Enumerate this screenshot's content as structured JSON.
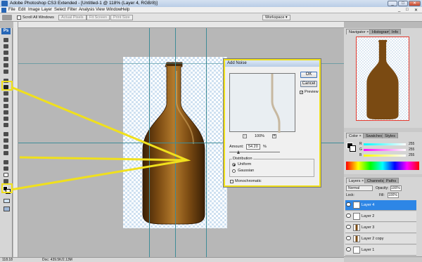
{
  "window": {
    "title": "Adobe Photoshop CS3 Extended - [Untitled-1 @ 118% (Layer 4, RGB/8)]",
    "min": "_",
    "max": "□",
    "close": "✕",
    "doc_min": "_",
    "doc_max": "□",
    "doc_close": "✕"
  },
  "menu": [
    "File",
    "Edit",
    "Image",
    "Layer",
    "Select",
    "Filter",
    "Analysis",
    "View",
    "Window",
    "Help"
  ],
  "options": {
    "scroll_all": "Scroll All Windows",
    "actual_pixels": "Actual Pixels",
    "fit_screen": "Fit Screen",
    "print_size": "Print Size",
    "workspace": "Workspace ▾"
  },
  "toolbox": {
    "logo": "Ps"
  },
  "dialog": {
    "title": "Add Noise",
    "ok": "OK",
    "cancel": "Cancel",
    "preview_label": "Preview",
    "preview_checked": true,
    "zoom": "100%",
    "zoom_minus": "-",
    "zoom_plus": "+",
    "amount_label": "Amount:",
    "amount_value": "54.20",
    "amount_unit": "%",
    "amount_fraction": 0.18,
    "distribution_label": "Distribution",
    "uniform": "Uniform",
    "gaussian": "Gaussian",
    "selected_distribution": "Uniform",
    "monochromatic": "Monochromatic"
  },
  "navigator": {
    "tabs": [
      "Navigator ×",
      "Histogram",
      "Info"
    ]
  },
  "color_panel": {
    "tabs": [
      "Color ×",
      "Swatches",
      "Styles"
    ],
    "rows": [
      {
        "label": "R",
        "value": "255",
        "color": "#ff4a4a"
      },
      {
        "label": "G",
        "value": "255",
        "color": "#3cc83c"
      },
      {
        "label": "B",
        "value": "255",
        "color": "#3c6cf0"
      }
    ]
  },
  "layers_panel": {
    "tabs": [
      "Layers ×",
      "Channels",
      "Paths"
    ],
    "blend_mode": "Normal",
    "opacity_label": "Opacity:",
    "opacity": "100%",
    "lock_label": "Lock:",
    "fill_label": "Fill:",
    "fill": "100%",
    "layers": [
      {
        "name": "Layer 4",
        "selected": true,
        "visible": true,
        "thumb": "blank"
      },
      {
        "name": "Layer 2",
        "selected": false,
        "visible": true,
        "thumb": "blank"
      },
      {
        "name": "Layer 3",
        "selected": false,
        "visible": true,
        "thumb": "bottle"
      },
      {
        "name": "Layer 2 copy",
        "selected": false,
        "visible": true,
        "thumb": "bottle"
      },
      {
        "name": "Layer 1",
        "selected": false,
        "visible": true,
        "thumb": "blank"
      }
    ]
  },
  "status": {
    "zoom": "118.18",
    "doc": "Doc: 439.5K/2.13M"
  },
  "colors": {
    "highlight": "#f0e01c",
    "bottle": "#7a4a12",
    "selection": "#2d86e6"
  }
}
